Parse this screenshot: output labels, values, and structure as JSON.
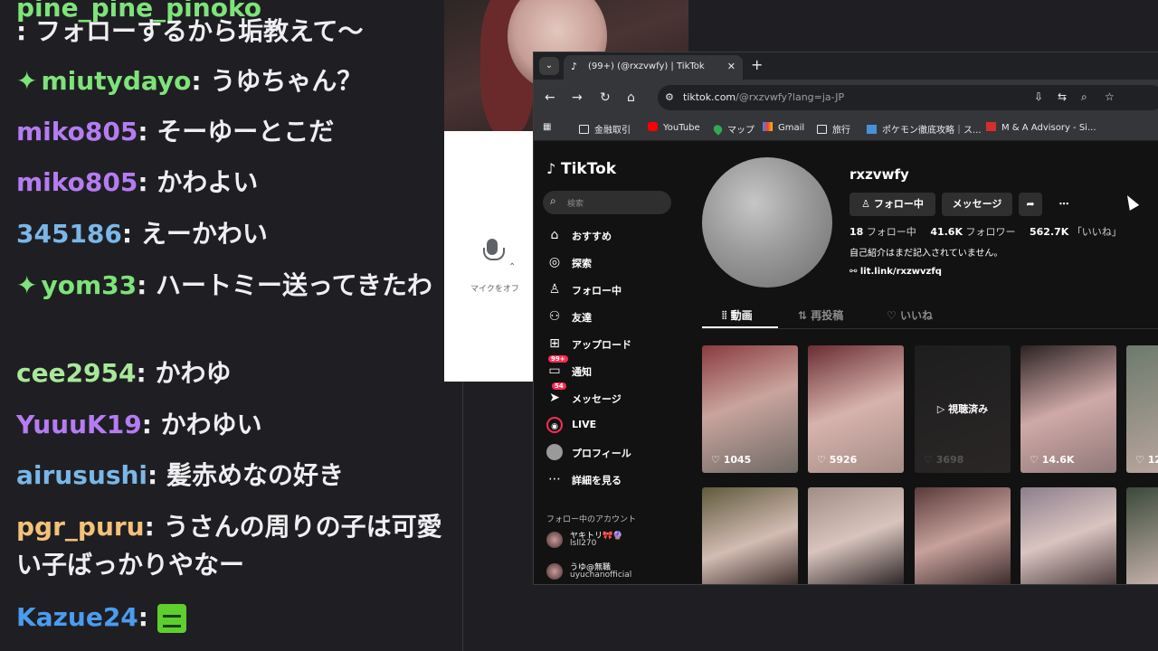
{
  "chat": [
    {
      "user": "pine_pine_pinoko",
      "msg": ": フォローするから垢教えて〜",
      "badge": false
    },
    {
      "user": "miutydayo",
      "msg": ": うゆちゃん？",
      "badge": true
    },
    {
      "user": "miko805",
      "msg": ": そーゆーとこだ",
      "badge": false
    },
    {
      "user": "miko805",
      "msg": ": かわよい",
      "badge": false
    },
    {
      "user": "345186",
      "msg": ": えーかわい",
      "badge": false
    },
    {
      "user": "yom33",
      "msg": ": ハートミー送ってきたわ",
      "badge": true
    },
    {
      "user": "cee2954",
      "msg": ": かわゆ",
      "badge": false
    },
    {
      "user": "YuuuK19",
      "msg": ": かわゆい",
      "badge": false
    },
    {
      "user": "airusushi",
      "msg": ": 髪赤めなの好き",
      "badge": false
    },
    {
      "user": "pgr_puru",
      "msg": ": うさんの周りの子は可愛い子ばっかりやなー",
      "badge": false
    },
    {
      "user": "Kazue24",
      "msg": ":",
      "badge": false
    }
  ],
  "chat_colors": [
    "#7ee37a",
    "#7ee37a",
    "#b57cf2",
    "#b57cf2",
    "#7ab7e8",
    "#7ee37a",
    "#a8e89a",
    "#b57cf2",
    "#7ab7e8",
    "#f2c27a",
    "#4a9cf0"
  ],
  "mic": {
    "label": "マイクをオフ"
  },
  "browser": {
    "tab_title": "(99+) (@rxzvwfy) | TikTok",
    "tab_close": "✕",
    "new_tab": "+",
    "url_host": "tiktok.com",
    "url_path": "/@rxzvwfy?lang=ja-JP",
    "bookmarks": [
      "金融取引",
      "YouTube",
      "マップ",
      "Gmail",
      "旅行",
      "ポケモン徹底攻略｜ス...",
      "M & A Advisory - Si..."
    ]
  },
  "tiktok": {
    "logo": "TikTok",
    "search_placeholder": "検索",
    "nav": [
      {
        "label": "おすすめ",
        "icon": "home-icon",
        "glyph": "⌂"
      },
      {
        "label": "探索",
        "icon": "compass-icon",
        "glyph": "◎"
      },
      {
        "label": "フォロー中",
        "icon": "following-icon",
        "glyph": "♙"
      },
      {
        "label": "友達",
        "icon": "friends-icon",
        "glyph": "⚇"
      },
      {
        "label": "アップロード",
        "icon": "upload-icon",
        "glyph": "⊞"
      },
      {
        "label": "通知",
        "icon": "inbox-icon",
        "glyph": "▭",
        "badge": "99+"
      },
      {
        "label": "メッセージ",
        "icon": "message-icon",
        "glyph": "➤",
        "badge": "54"
      },
      {
        "label": "LIVE",
        "icon": "live-icon",
        "glyph": "◉"
      },
      {
        "label": "プロフィール",
        "icon": "profile-icon",
        "glyph": "●"
      },
      {
        "label": "詳細を見る",
        "icon": "more-icon",
        "glyph": "⋯"
      }
    ],
    "following_header": "フォロー中のアカウント",
    "following_accounts": [
      {
        "name": "ヤキトリ🎀🔮",
        "id": "lsll270"
      },
      {
        "name": "うゆ@無職",
        "id": "uyuchanofficial"
      }
    ],
    "profile": {
      "username": "rxzvwfy",
      "following_button": "フォロー中",
      "message_button": "メッセージ",
      "following_count": "18",
      "following_label": "フォロー中",
      "followers_count": "41.6K",
      "followers_label": "フォロワー",
      "likes_count": "562.7K",
      "likes_label": "「いいね」",
      "bio": "自己紹介はまだ記入されていません。",
      "link": "lit.link/rxzwvzfq"
    },
    "tabs": [
      "動画",
      "再投稿",
      "いいね"
    ],
    "videos_row1": [
      "1045",
      "5926",
      "3698",
      "14.6K",
      "12"
    ],
    "watched_label": "視聴済み"
  }
}
